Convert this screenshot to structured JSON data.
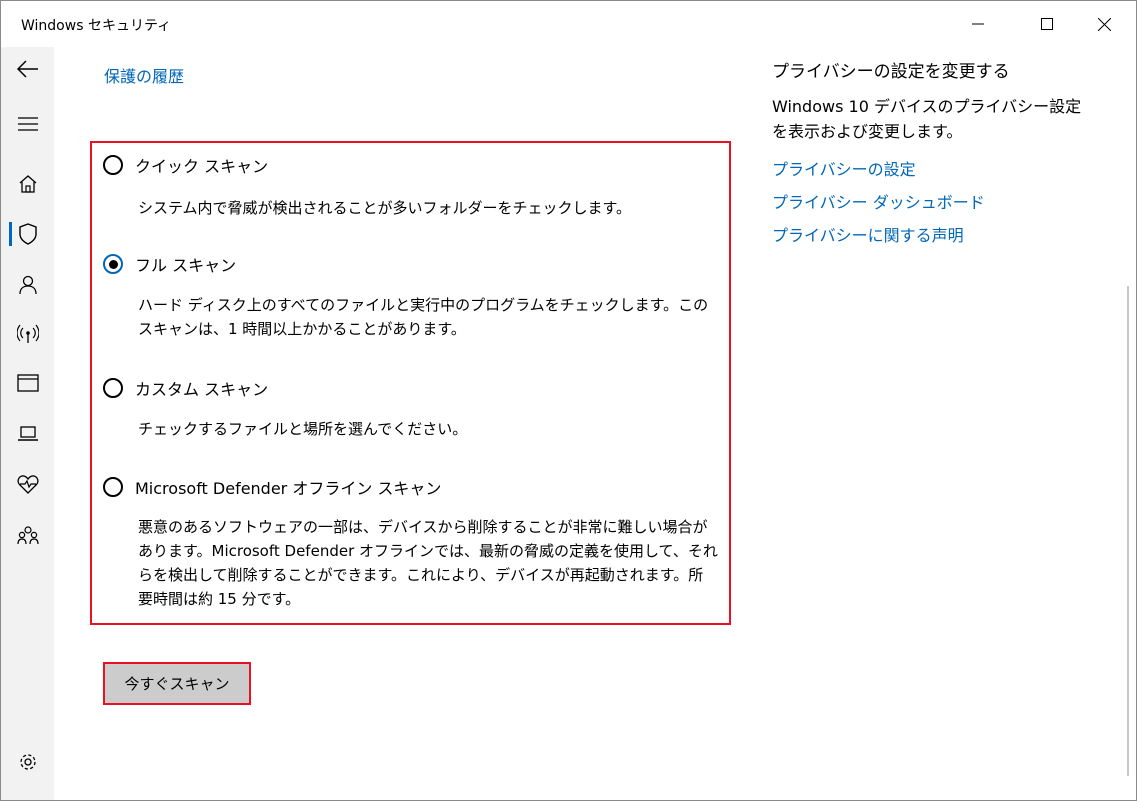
{
  "window": {
    "title": "Windows セキュリティ"
  },
  "sidebar": {
    "items": [
      {
        "icon": "back-arrow-icon"
      },
      {
        "icon": "hamburger-menu-icon"
      },
      {
        "icon": "home-icon"
      },
      {
        "icon": "shield-icon",
        "active": true
      },
      {
        "icon": "person-icon"
      },
      {
        "icon": "wireless-icon"
      },
      {
        "icon": "app-browser-icon"
      },
      {
        "icon": "laptop-icon"
      },
      {
        "icon": "heart-pulse-icon"
      },
      {
        "icon": "family-icon"
      },
      {
        "icon": "gear-icon"
      }
    ]
  },
  "main": {
    "history_link": "保護の履歴",
    "scan_options": [
      {
        "label": "クイック スキャン",
        "description": "システム内で脅威が検出されることが多いフォルダーをチェックします。",
        "selected": false
      },
      {
        "label": "フル スキャン",
        "description": "ハード ディスク上のすべてのファイルと実行中のプログラムをチェックします。このスキャンは、1 時間以上かかることがあります。",
        "selected": true
      },
      {
        "label": "カスタム スキャン",
        "description": "チェックするファイルと場所を選んでください。",
        "selected": false
      },
      {
        "label": "Microsoft Defender オフライン スキャン",
        "description": "悪意のあるソフトウェアの一部は、デバイスから削除することが非常に難しい場合があります。Microsoft Defender オフラインでは、最新の脅威の定義を使用して、それらを検出して削除することができます。これにより、デバイスが再起動されます。所要時間は約 15 分です。",
        "selected": false
      }
    ],
    "scan_button": "今すぐスキャン"
  },
  "right_panel": {
    "title": "プライバシーの設定を変更する",
    "description": "Windows 10 デバイスのプライバシー設定を表示および変更します。",
    "links": [
      "プライバシーの設定",
      "プライバシー ダッシュボード",
      "プライバシーに関する声明"
    ]
  },
  "colors": {
    "accent": "#0067b8",
    "highlight": "#e81123",
    "sidebar_bg": "#f2f2f2",
    "button_bg": "#cccccc"
  }
}
